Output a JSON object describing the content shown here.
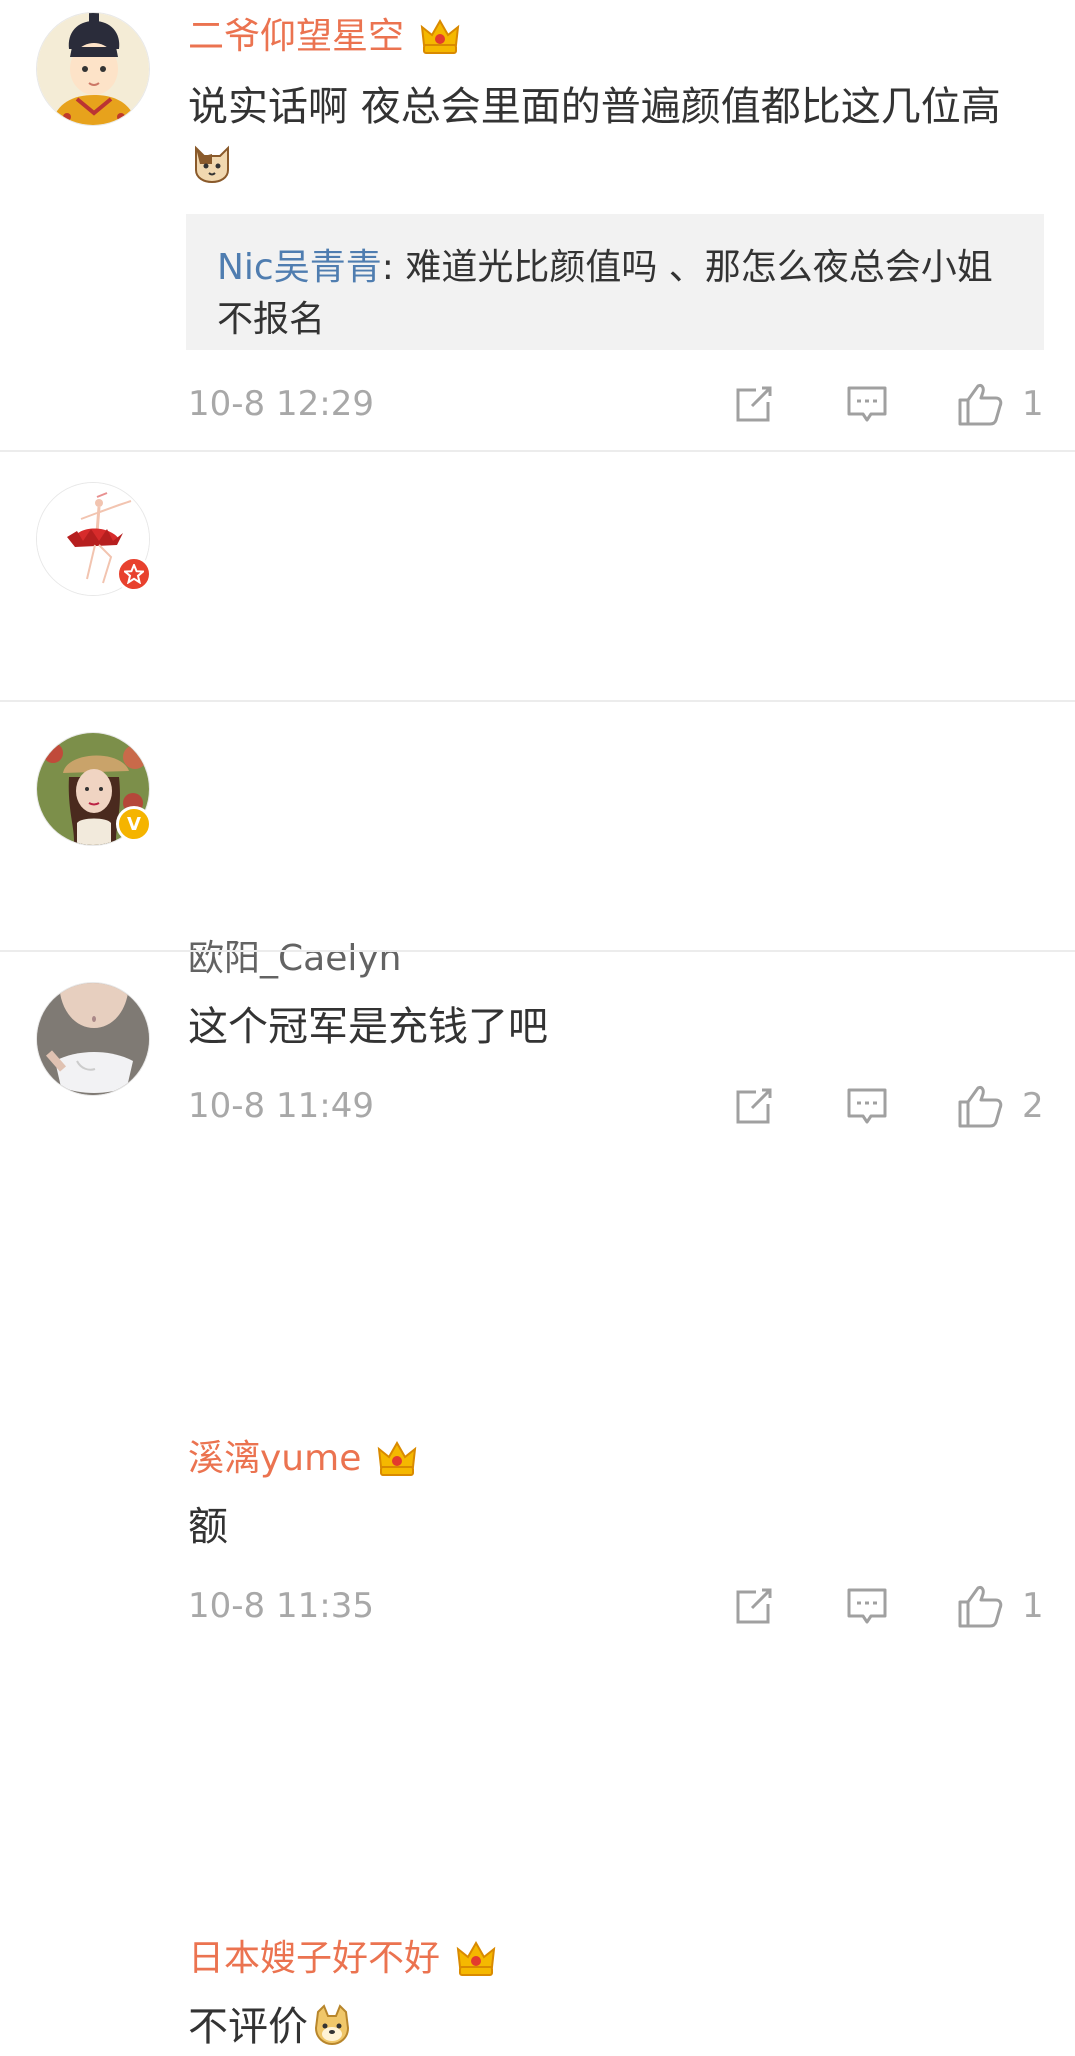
{
  "colors": {
    "username_vip": "#eb7350",
    "username_plain": "#636363",
    "quote_name": "#4f7db0",
    "meta": "#a8a8a8",
    "divider": "#ececec"
  },
  "comments": [
    {
      "username": "二爷仰望星空",
      "crown_icon": "crown-icon",
      "text": "说实话啊 夜总会里面的普遍颜值都比这几位高",
      "emoji": "cat-emoji",
      "quote": {
        "name": "Nic吴青青",
        "separator": ": ",
        "text": "难道光比颜值吗 、那怎么夜总会小姐不报名"
      },
      "time": "10-8 12:29",
      "likes": "1"
    },
    {
      "username": "欧阳_Caelyn",
      "badge": "red-star-badge",
      "text": "这个冠军是充钱了吧",
      "time": "10-8 11:49",
      "likes": "2"
    },
    {
      "username": "溪漓yume",
      "crown_icon": "crown-icon",
      "badge": "verified-v-badge",
      "badge_text": "V",
      "text": "额",
      "time": "10-8 11:35",
      "likes": "1"
    },
    {
      "username": "日本嫂子好不好",
      "crown_icon": "crown-icon",
      "text": "不评价",
      "emoji": "doge-emoji"
    }
  ]
}
